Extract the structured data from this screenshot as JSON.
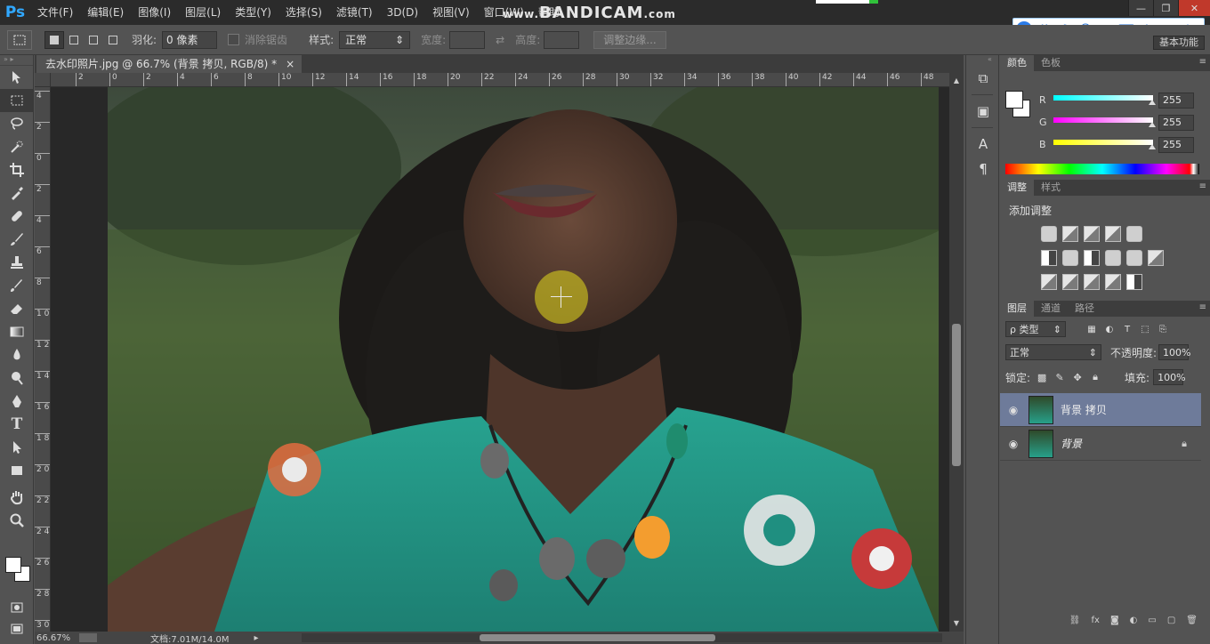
{
  "app": {
    "logo": "Ps"
  },
  "menu": [
    "文件(F)",
    "编辑(E)",
    "图像(I)",
    "图层(L)",
    "类型(Y)",
    "选择(S)",
    "滤镜(T)",
    "3D(D)",
    "视图(V)",
    "窗口(W)",
    "帮助"
  ],
  "watermark": {
    "prefix": "www.",
    "text": "BANDICAM",
    "suffix": ".com"
  },
  "ime": {
    "lang_label": "英",
    "icons": [
      "sogou-logo-icon",
      "moon-icon",
      "emoji-icon",
      "scissors-icon",
      "keyboard-icon",
      "shirt-icon",
      "user-icon",
      "gear-icon"
    ]
  },
  "options": {
    "feather_label": "羽化:",
    "feather_value": "0 像素",
    "antialias_label": "消除锯齿",
    "style_label": "样式:",
    "style_value": "正常",
    "width_label": "宽度:",
    "height_label": "高度:",
    "refine_edge_label": "调整边缘...",
    "workspace": "基本功能"
  },
  "document": {
    "tab_title": "去水印照片.jpg @ 66.7% (背景 拷贝, RGB/8) *",
    "zoom": "66.67%",
    "doc_info": "文档:7.01M/14.0M"
  },
  "ruler": {
    "h_labels": [
      "2",
      "0",
      "2",
      "4",
      "6",
      "8",
      "10",
      "12",
      "14",
      "16",
      "18",
      "20",
      "22",
      "24",
      "26",
      "28",
      "30",
      "32",
      "34",
      "36",
      "38",
      "40",
      "42",
      "44",
      "46",
      "48"
    ],
    "v_labels": [
      "4",
      "2",
      "0",
      "2",
      "4",
      "6",
      "8",
      "1 0",
      "1 2",
      "1 4",
      "1 6",
      "1 8",
      "2 0",
      "2 2",
      "2 4",
      "2 6",
      "2 8",
      "3 0"
    ]
  },
  "color_panel": {
    "tabs": [
      "颜色",
      "色板"
    ],
    "r_label": "R",
    "g_label": "G",
    "b_label": "B",
    "r_value": "255",
    "g_value": "255",
    "b_value": "255",
    "foreground": "#ffffff",
    "background": "#ffffff"
  },
  "adjust_panel": {
    "tabs": [
      "调整",
      "样式"
    ],
    "title": "添加调整"
  },
  "layers_panel": {
    "tabs": [
      "图层",
      "通道",
      "路径"
    ],
    "filter_label": "ρ 类型",
    "blend_mode": "正常",
    "opacity_label": "不透明度:",
    "opacity_value": "100%",
    "lock_label": "锁定:",
    "fill_label": "填充:",
    "fill_value": "100%",
    "layers": [
      {
        "name": "背景 拷贝",
        "selected": true,
        "locked": false
      },
      {
        "name": "背景",
        "selected": false,
        "locked": true
      }
    ]
  }
}
